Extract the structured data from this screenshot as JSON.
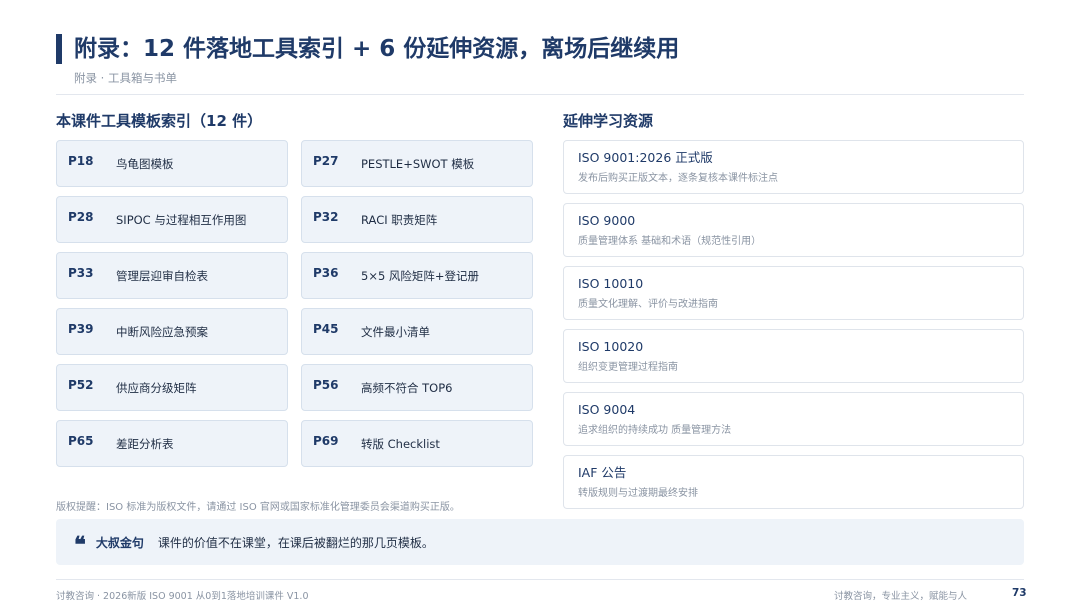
{
  "header": {
    "title": "附录：12 件落地工具索引 + 6 份延伸资源，离场后继续用",
    "subtitle": "附录 · 工具箱与书单"
  },
  "tools": {
    "heading": "本课件工具模板索引（12 件）",
    "items": [
      {
        "page": "P18",
        "name": "鸟龟图模板"
      },
      {
        "page": "P27",
        "name": "PESTLE+SWOT 模板"
      },
      {
        "page": "P28",
        "name": "SIPOC 与过程相互作用图"
      },
      {
        "page": "P32",
        "name": "RACI 职责矩阵"
      },
      {
        "page": "P33",
        "name": "管理层迎审自检表"
      },
      {
        "page": "P36",
        "name": "5×5 风险矩阵+登记册"
      },
      {
        "page": "P39",
        "name": "中断风险应急预案"
      },
      {
        "page": "P45",
        "name": "文件最小清单"
      },
      {
        "page": "P52",
        "name": "供应商分级矩阵"
      },
      {
        "page": "P56",
        "name": "高频不符合 TOP6"
      },
      {
        "page": "P65",
        "name": "差距分析表"
      },
      {
        "page": "P69",
        "name": "转版 Checklist"
      }
    ],
    "copyright": "版权提醒：ISO 标准为版权文件，请通过 ISO 官网或国家标准化管理委员会渠道购买正版。"
  },
  "resources": {
    "heading": "延伸学习资源",
    "items": [
      {
        "name": "ISO 9001:2026 正式版",
        "desc": "发布后购买正版文本，逐条复核本课件标注点"
      },
      {
        "name": "ISO 9000",
        "desc": "质量管理体系 基础和术语（规范性引用）"
      },
      {
        "name": "ISO 10010",
        "desc": "质量文化理解、评价与改进指南"
      },
      {
        "name": "ISO 10020",
        "desc": "组织变更管理过程指南"
      },
      {
        "name": "ISO 9004",
        "desc": "追求组织的持续成功 质量管理方法"
      },
      {
        "name": "IAF 公告",
        "desc": "转版规则与过渡期最终安排"
      }
    ]
  },
  "quote": {
    "icon": "quote-mark-icon",
    "glyph": "❝",
    "label": "大叔金句",
    "text": "课件的价值不在课堂，在课后被翻烂的那几页模板。"
  },
  "footer": {
    "left": "讨教咨询 · 2026新版 ISO 9001 从0到1落地培训课件 V1.0",
    "right": "讨教咨询，专业主义，赋能与人",
    "page": "73"
  },
  "colors": {
    "primary": "#1f3a68",
    "card_bg": "#eef3f9",
    "muted": "#8a94a3"
  }
}
